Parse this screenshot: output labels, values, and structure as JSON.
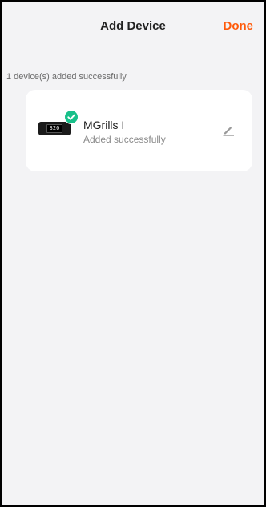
{
  "header": {
    "title": "Add Device",
    "done_label": "Done"
  },
  "summary": "1 device(s) added successfully",
  "device": {
    "name": "MGrills I",
    "status": "Added successfully",
    "display_text": "320"
  },
  "colors": {
    "accent": "#ff5a0a",
    "success": "#19c08a",
    "background": "#f3f3f5"
  },
  "icons": {
    "status": "check-circle-icon",
    "edit": "pencil-icon"
  }
}
